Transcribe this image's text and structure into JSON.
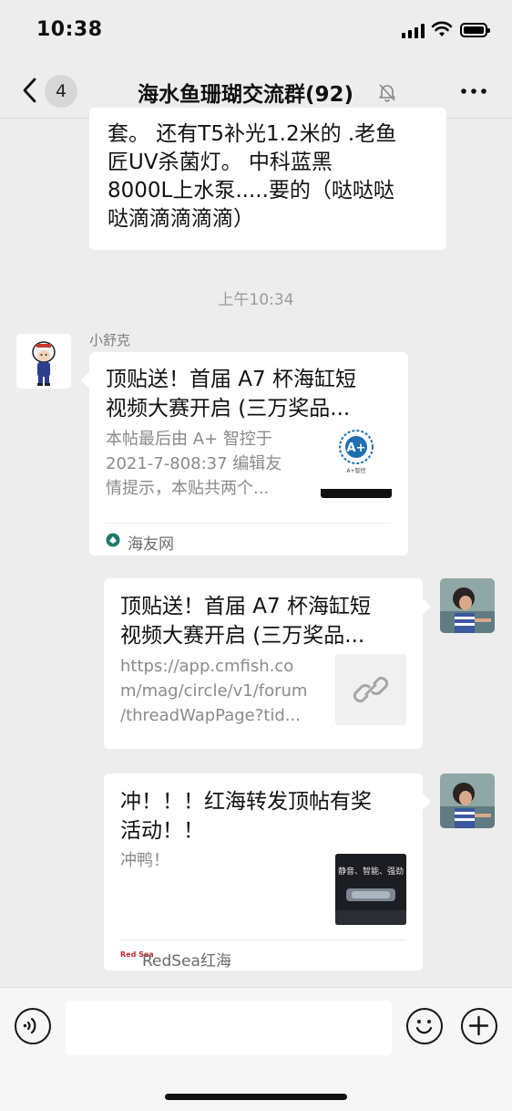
{
  "status_bar": {
    "time": "10:38"
  },
  "nav": {
    "back_badge": "4",
    "title": "海水鱼珊瑚交流群(92)",
    "icons": {
      "back": "chevron-left-icon",
      "mute": "bell-slash-icon",
      "more": "more-dots-icon"
    }
  },
  "messages": [
    {
      "type": "text",
      "lines": [
        "套。 还有T5补光1.2米的 .老鱼",
        "匠UV杀菌灯。 中科蓝黑",
        "8000L上水泵.....要的（哒哒哒",
        "哒滴滴滴滴滴）"
      ]
    },
    {
      "type": "timestamp",
      "text": "上午10:34"
    },
    {
      "type": "link_card",
      "sender": "小舒克",
      "title_lines": [
        "顶贴送！首届 A7 杯海缸短",
        "视频大赛开启 (三万奖品..."
      ],
      "desc_lines": [
        "本帖最后由 A+ 智控于",
        "2021-7-808:37 编辑友",
        "情提示，本贴共两个..."
      ],
      "source": "海友网",
      "thumb_text": "A+智控"
    },
    {
      "type": "link_card",
      "title_lines": [
        "顶贴送！首届 A7 杯海缸短",
        "视频大赛开启 (三万奖品..."
      ],
      "desc_lines": [
        "https://app.cmfish.co",
        "m/mag/circle/v1/forum",
        "/threadWapPage?tid..."
      ],
      "thumb_icon": "link-icon"
    },
    {
      "type": "link_card",
      "title_lines": [
        "冲！！！红海转发顶帖有奖",
        "活动！！"
      ],
      "desc_lines": [
        "冲鸭！"
      ],
      "source": "RedSea红海",
      "source_logo_text": "Red Sea",
      "thumb_text": "静音、智能、强劲"
    }
  ],
  "input_bar": {
    "placeholder": "",
    "icons": {
      "voice": "voice-icon",
      "emoji": "emoji-icon",
      "more": "plus-icon"
    }
  },
  "colors": {
    "background": "#ededed",
    "bubble": "#ffffff",
    "footer_bar": "#f6f6f6"
  }
}
